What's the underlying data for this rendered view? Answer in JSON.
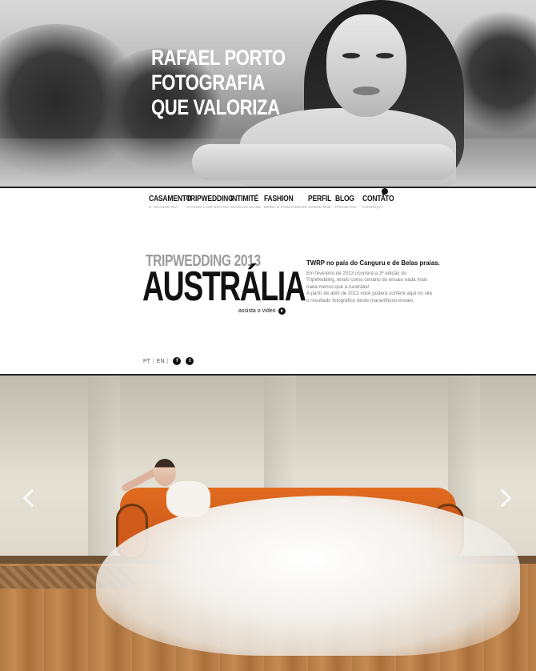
{
  "hero": {
    "title_lines": [
      "RAFAEL PORTO",
      "FOTOGRAFIA",
      "QUE VALORIZA"
    ]
  },
  "nav": {
    "items": [
      {
        "label": "CASAMENTO",
        "sub": "O GRANDE DIA"
      },
      {
        "label": "TRIPWEDDING",
        "sub": "VIAGEM COM NOIVOS"
      },
      {
        "label": "INTIMITÉ",
        "sub": "SENSUALIDADE"
      },
      {
        "label": "FASHION",
        "sub": "MODA E PUBLICIDADE"
      },
      {
        "label": "PERFIL",
        "sub": "SOBRE MIM"
      },
      {
        "label": "BLOG",
        "sub": "PROJETOS"
      },
      {
        "label": "CONTATO",
        "sub": "CONHEÇA+"
      }
    ]
  },
  "feature": {
    "kicker": "TRIPWEDDING 2013",
    "title": "AUSTRÁLIA",
    "watch_label": "assista o vídeo",
    "desc_title": "TWRP no país do Canguru e de Belas praias.",
    "desc_body_1": "Em fevereiro de 2013 ocorrerá a 3ª edição do TripWedding, tendo como cenário do ensaio nada mais nada menos que a Austrália!",
    "desc_body_2": "A partir de abril de 2013 você poderá conferir aqui no site o resultado fotográfico deste maravilhoso ensaio."
  },
  "footer": {
    "lang_pt": "PT",
    "lang_en": "EN",
    "sep": "|",
    "facebook_glyph": "f",
    "twitter_glyph": "t"
  },
  "slideshow": {
    "prev_icon": "chevron-left-icon",
    "next_icon": "chevron-right-icon"
  },
  "colors": {
    "accent_orange": "#d25d1b",
    "text_dark": "#111111",
    "text_gray": "#9c9c9c"
  }
}
